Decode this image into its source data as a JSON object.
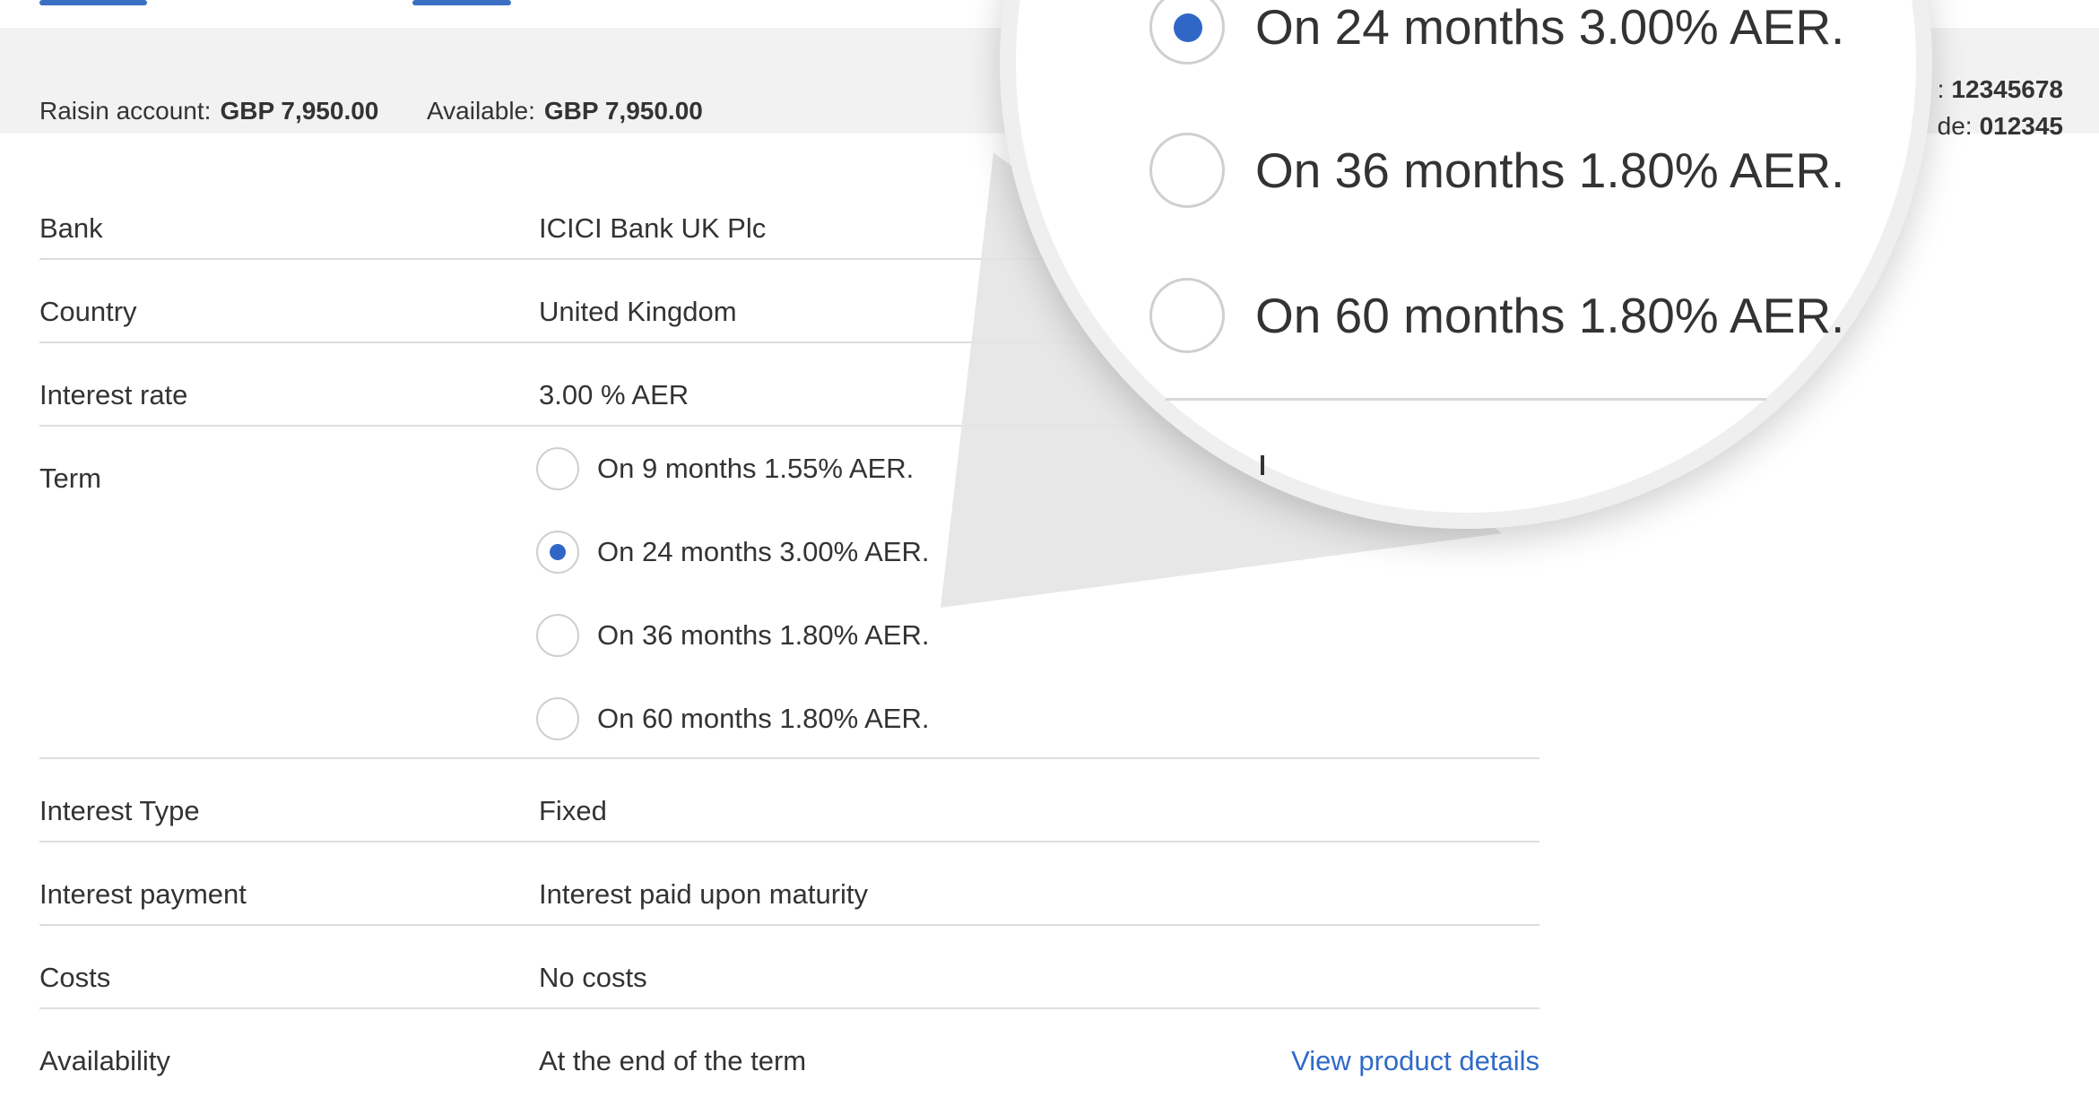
{
  "account_bar": {
    "raisin_label": "Raisin account:",
    "raisin_value": "GBP 7,950.00",
    "available_label": "Available:",
    "available_value": "GBP 7,950.00",
    "account_label_fragment": ":",
    "account_number": "12345678",
    "sort_label_fragment": "de:",
    "sort_code": "012345"
  },
  "details": {
    "bank": {
      "label": "Bank",
      "value": "ICICI Bank UK Plc"
    },
    "country": {
      "label": "Country",
      "value": "United Kingdom"
    },
    "interest_rate": {
      "label": "Interest rate",
      "value": "3.00 % AER"
    },
    "term": {
      "label": "Term",
      "options": [
        {
          "text": "On 9 months 1.55% AER.",
          "selected": false
        },
        {
          "text": "On 24 months 3.00% AER.",
          "selected": true
        },
        {
          "text": "On 36 months 1.80% AER.",
          "selected": false
        },
        {
          "text": "On 60 months 1.80% AER.",
          "selected": false
        }
      ]
    },
    "interest_type": {
      "label": "Interest Type",
      "value": "Fixed"
    },
    "interest_payment": {
      "label": "Interest payment",
      "value": "Interest paid upon maturity"
    },
    "costs": {
      "label": "Costs",
      "value": "No costs"
    },
    "availability": {
      "label": "Availability",
      "value": "At the end of the term",
      "link": "View product details"
    }
  },
  "magnifier": {
    "options": [
      {
        "text": "On 24 months 3.00% AER.",
        "selected": true
      },
      {
        "text": "On 36 months 1.80% AER.",
        "selected": false
      },
      {
        "text": "On 60 months 1.80% AER.",
        "selected": false
      }
    ]
  },
  "colors": {
    "accent": "#3067c7",
    "link": "#2f6ac8",
    "bar_bg": "#f2f2f2",
    "divider": "#dedede"
  }
}
